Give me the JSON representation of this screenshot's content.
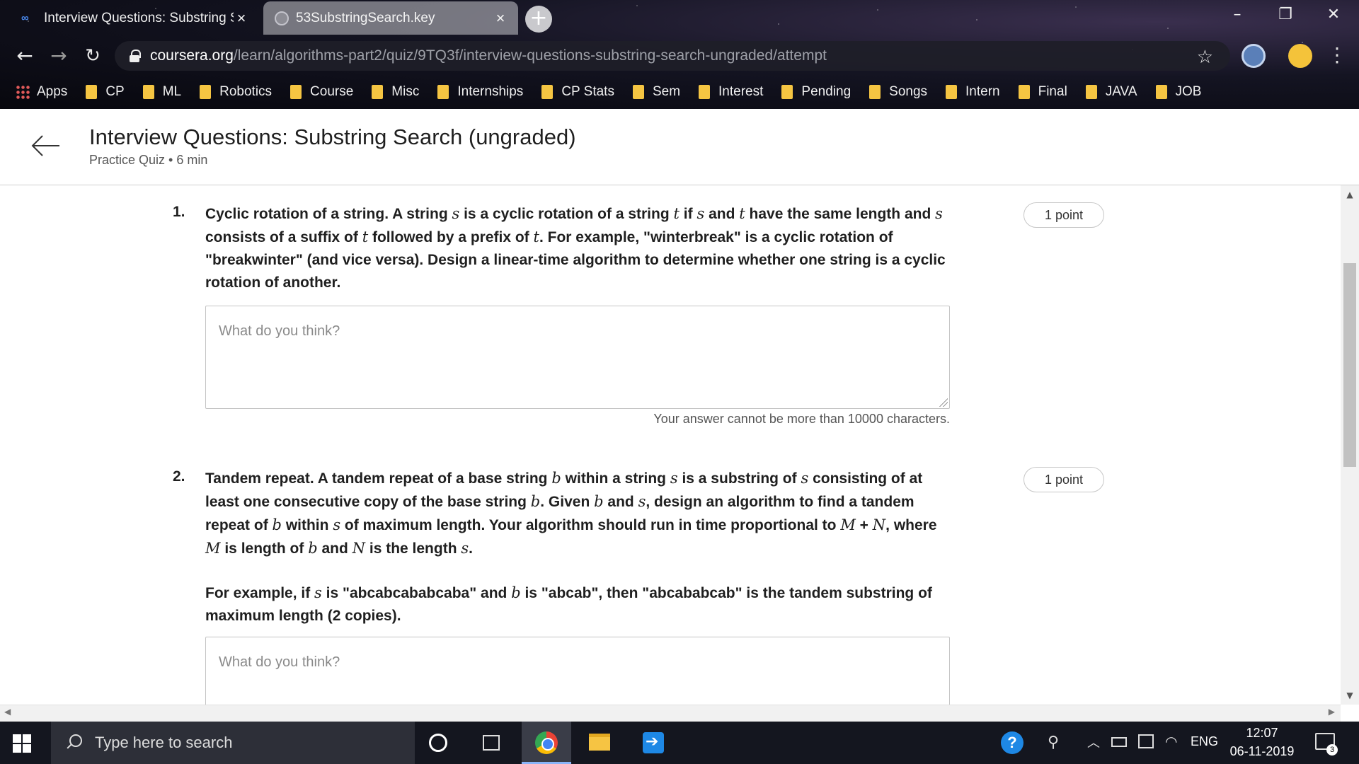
{
  "browser": {
    "tabs": [
      {
        "title": "Interview Questions: Substring Se",
        "favicon": "coursera-icon",
        "active": true
      },
      {
        "title": "53SubstringSearch.key",
        "favicon": "keynote-icon",
        "active": false
      }
    ],
    "url_domain": "coursera.org",
    "url_path": "/learn/algorithms-part2/quiz/9TQ3f/interview-questions-substring-search-ungraded/attempt",
    "bookmarks": [
      "Apps",
      "CP",
      "ML",
      "Robotics",
      "Course",
      "Misc",
      "Internships",
      "CP Stats",
      "Sem",
      "Interest",
      "Pending",
      "Songs",
      "Intern",
      "Final",
      "JAVA",
      "JOB"
    ]
  },
  "header": {
    "title": "Interview Questions: Substring Search (ungraded)",
    "subtitle": "Practice Quiz • 6 min"
  },
  "questions": [
    {
      "number": "1.",
      "points": "1 point",
      "placeholder": "What do you think?",
      "limit_note": "Your answer cannot be more than 10000 characters."
    },
    {
      "number": "2.",
      "points": "1 point",
      "placeholder": "What do you think?"
    }
  ],
  "taskbar": {
    "search_placeholder": "Type here to search",
    "language": "ENG",
    "time": "12:07",
    "date": "06-11-2019",
    "notification_count": "3"
  },
  "colors": {
    "link_accent": "#0056d2",
    "chrome_bg": "#07070d",
    "taskbar_bg": "#14161f"
  }
}
